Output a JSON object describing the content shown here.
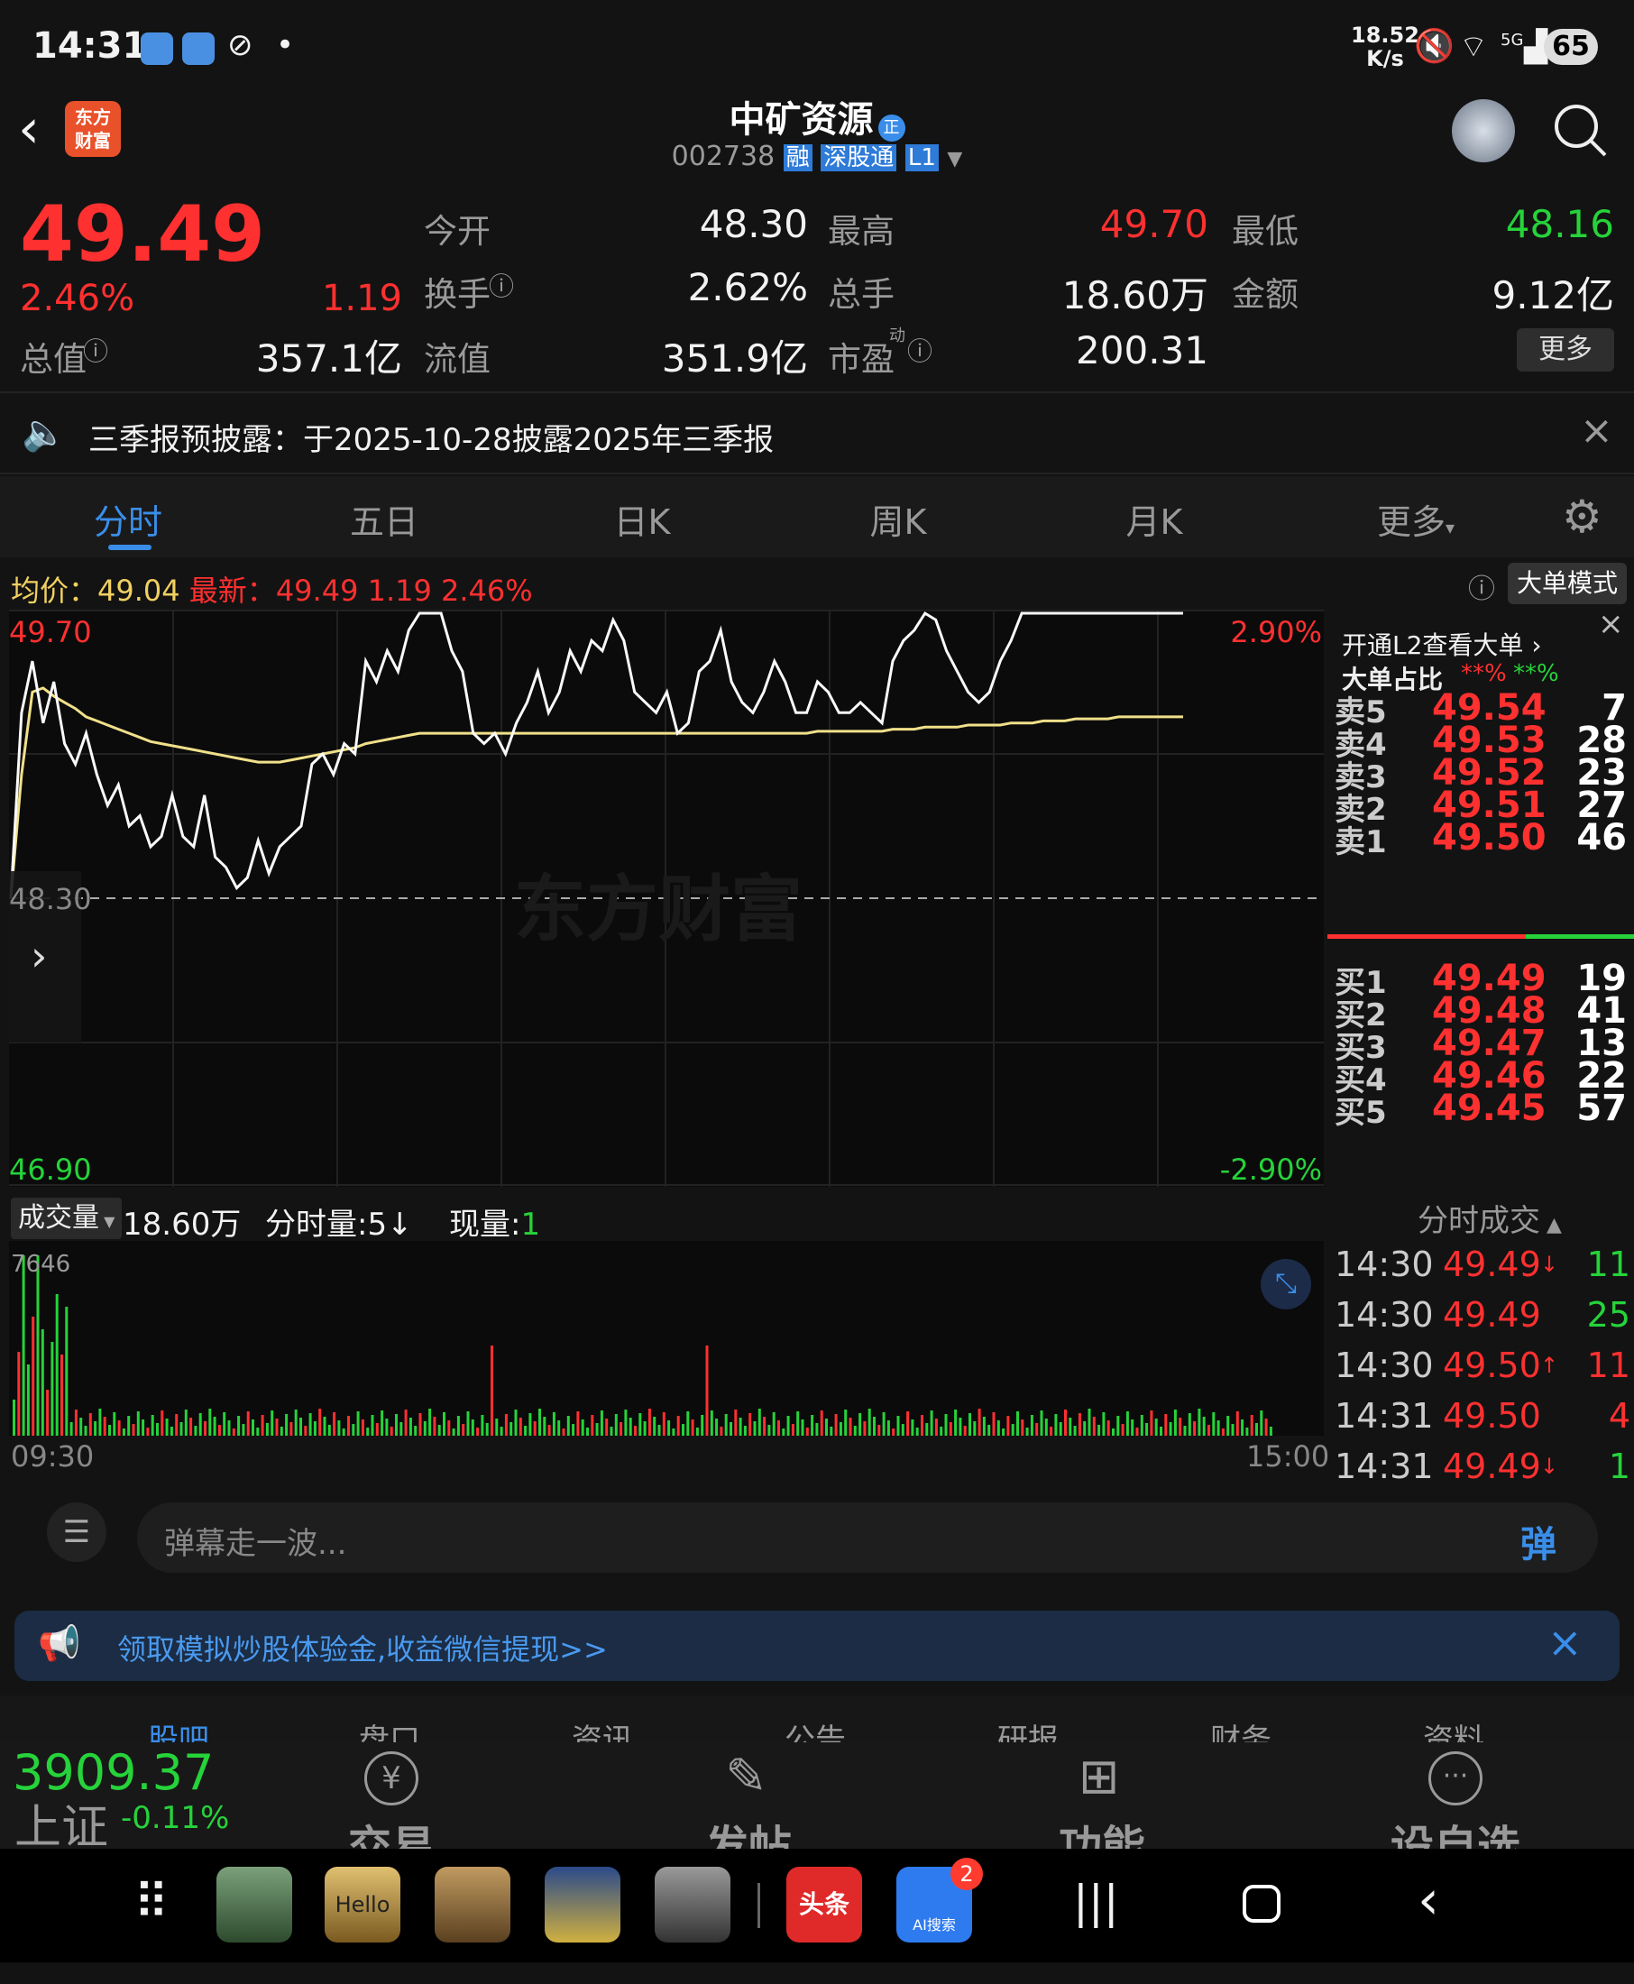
{
  "status": {
    "time": "14:31",
    "speed_value": "18.52",
    "speed_unit": "K/s",
    "network": "5G",
    "battery": "65"
  },
  "header": {
    "title": "中矿资源",
    "title_badge": "正",
    "code": "002738",
    "tags": [
      "融",
      "深股通",
      "L1"
    ],
    "logo_line1": "东方",
    "logo_line2": "财富"
  },
  "quote": {
    "price": "49.49",
    "pct": "2.46%",
    "change": "1.19",
    "total_value_label": "总值",
    "total_value": "357.1亿",
    "open_label": "今开",
    "open": "48.30",
    "high_label": "最高",
    "high": "49.70",
    "low_label": "最低",
    "low": "48.16",
    "turnover_label": "换手",
    "turnover": "2.62%",
    "volume_label": "总手",
    "volume": "18.60万",
    "amount_label": "金额",
    "amount": "9.12亿",
    "float_label": "流值",
    "float_value": "351.9亿",
    "pe_label": "市盈",
    "pe_sup": "动",
    "pe": "200.31",
    "more": "更多"
  },
  "notice": {
    "text": "三季报预披露：于2025-10-28披露2025年三季报"
  },
  "tabs": [
    "分时",
    "五日",
    "日K",
    "周K",
    "月K",
    "更多"
  ],
  "chart_info": {
    "avg_label": "均价：",
    "avg": "49.04",
    "latest_label": "最新：",
    "latest": "49.49",
    "change": "1.19",
    "pct": "2.46%",
    "mode_button": "大单模式"
  },
  "chart_data": {
    "type": "line",
    "ylim": [
      46.9,
      49.7
    ],
    "y_top_label": "49.70",
    "y_bottom_label": "46.90",
    "y_mid_label": "48.30",
    "pct_top": "2.90%",
    "pct_bottom": "-2.90%",
    "x_start": "09:30",
    "x_end": "15:00",
    "price": [
      48.3,
      49.2,
      49.45,
      49.15,
      49.35,
      49.05,
      48.95,
      49.1,
      48.9,
      48.75,
      48.85,
      48.65,
      48.7,
      48.55,
      48.6,
      48.8,
      48.6,
      48.55,
      48.8,
      48.5,
      48.45,
      48.35,
      48.4,
      48.58,
      48.42,
      48.55,
      48.6,
      48.65,
      48.95,
      49.0,
      48.9,
      49.05,
      49.0,
      49.45,
      49.35,
      49.5,
      49.4,
      49.6,
      49.8,
      49.7,
      49.95,
      49.5,
      49.4,
      49.1,
      49.05,
      49.1,
      49.0,
      49.15,
      49.25,
      49.4,
      49.2,
      49.3,
      49.5,
      49.4,
      49.55,
      49.5,
      49.65,
      49.55,
      49.3,
      49.25,
      49.2,
      49.3,
      49.1,
      49.15,
      49.4,
      49.45,
      49.6,
      49.35,
      49.25,
      49.2,
      49.3,
      49.45,
      49.35,
      49.2,
      49.2,
      49.35,
      49.3,
      49.2,
      49.2,
      49.25,
      49.2,
      49.15,
      49.45,
      49.55,
      49.6,
      49.7,
      49.65,
      49.5,
      49.4,
      49.3,
      49.25,
      49.3,
      49.45,
      49.55,
      49.75,
      49.7,
      49.9,
      50.0,
      49.8,
      50.05,
      49.8,
      49.7,
      49.85,
      49.75,
      49.8,
      49.9,
      49.75,
      49.95,
      49.9,
      49.8
    ],
    "avg": [
      48.3,
      48.9,
      49.3,
      49.32,
      49.28,
      49.25,
      49.22,
      49.18,
      49.16,
      49.14,
      49.12,
      49.1,
      49.08,
      49.06,
      49.05,
      49.04,
      49.03,
      49.02,
      49.01,
      49.0,
      48.99,
      48.98,
      48.97,
      48.96,
      48.96,
      48.96,
      48.97,
      48.98,
      48.99,
      49.0,
      49.01,
      49.02,
      49.03,
      49.05,
      49.06,
      49.07,
      49.08,
      49.09,
      49.1,
      49.1,
      49.1,
      49.1,
      49.1,
      49.1,
      49.1,
      49.1,
      49.1,
      49.1,
      49.1,
      49.1,
      49.1,
      49.1,
      49.1,
      49.1,
      49.1,
      49.1,
      49.1,
      49.1,
      49.1,
      49.1,
      49.1,
      49.1,
      49.1,
      49.1,
      49.1,
      49.1,
      49.1,
      49.1,
      49.1,
      49.1,
      49.1,
      49.1,
      49.1,
      49.1,
      49.1,
      49.11,
      49.11,
      49.11,
      49.11,
      49.11,
      49.11,
      49.11,
      49.12,
      49.12,
      49.12,
      49.13,
      49.13,
      49.13,
      49.13,
      49.14,
      49.14,
      49.14,
      49.14,
      49.15,
      49.15,
      49.15,
      49.16,
      49.16,
      49.16,
      49.17,
      49.17,
      49.17,
      49.17,
      49.18,
      49.18,
      49.18,
      49.18,
      49.18,
      49.18,
      49.18
    ]
  },
  "orderbook": {
    "link": "开通L2查看大单",
    "ratio_label": "大单占比",
    "ratio_red": "**%",
    "ratio_green": "**%",
    "asks": [
      {
        "label": "卖5",
        "price": "49.54",
        "vol": "7"
      },
      {
        "label": "卖4",
        "price": "49.53",
        "vol": "28"
      },
      {
        "label": "卖3",
        "price": "49.52",
        "vol": "23"
      },
      {
        "label": "卖2",
        "price": "49.51",
        "vol": "27"
      },
      {
        "label": "卖1",
        "price": "49.50",
        "vol": "46"
      }
    ],
    "bids": [
      {
        "label": "买1",
        "price": "49.49",
        "vol": "19"
      },
      {
        "label": "买2",
        "price": "49.48",
        "vol": "41"
      },
      {
        "label": "买3",
        "price": "49.47",
        "vol": "13"
      },
      {
        "label": "买4",
        "price": "49.46",
        "vol": "22"
      },
      {
        "label": "买5",
        "price": "49.45",
        "vol": "57"
      }
    ]
  },
  "volume": {
    "label": "成交量",
    "total": "18.60万",
    "minute_label": "分时量:5",
    "arrow": "↓",
    "now_label": "现量:",
    "now": "1",
    "max": "7646"
  },
  "ticks": {
    "title": "分时成交",
    "rows": [
      {
        "t": "14:30",
        "p": "49.49",
        "a": "↓",
        "v": "11"
      },
      {
        "t": "14:30",
        "p": "49.49",
        "a": "",
        "v": "25"
      },
      {
        "t": "14:30",
        "p": "49.50",
        "a": "↑",
        "v": "11"
      },
      {
        "t": "14:31",
        "p": "49.50",
        "a": "",
        "v": "4"
      },
      {
        "t": "14:31",
        "p": "49.49",
        "a": "↓",
        "v": "1"
      }
    ]
  },
  "danmu": {
    "placeholder": "弹幕走一波...",
    "button": "弹"
  },
  "promo": {
    "text": "领取模拟炒股体验金,收益微信提现>>"
  },
  "subtabs": [
    "股吧",
    "盘口",
    "资讯",
    "公告",
    "研报",
    "财务",
    "资料"
  ],
  "bottom": {
    "index_value": "3909.37",
    "index_name": "上证",
    "index_pct": "-0.11%",
    "trade": "交易",
    "post": "发帖",
    "func": "功能",
    "watch": "设自选"
  },
  "apps": {
    "toutiao": "头条",
    "hello": "Hello",
    "badge": "2",
    "baidu_ai": "AI搜索"
  },
  "colors": {
    "up": "#ff3030",
    "down": "#26d33a",
    "accent": "#3a8eea"
  }
}
